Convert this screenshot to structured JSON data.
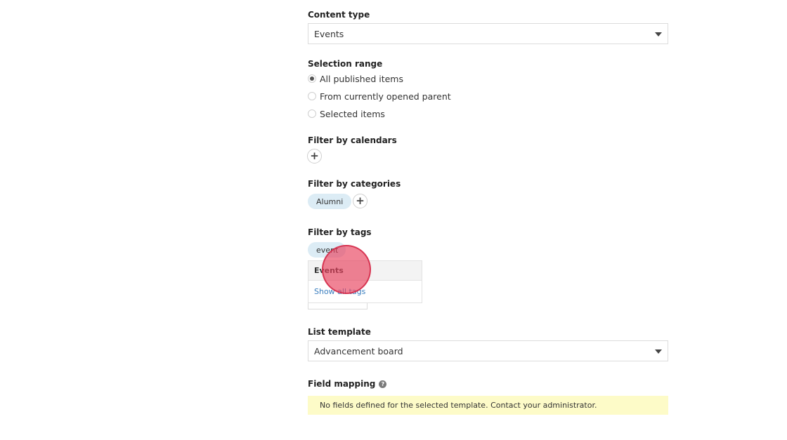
{
  "content_type": {
    "label": "Content type",
    "value": "Events"
  },
  "selection_range": {
    "label": "Selection range",
    "options": [
      {
        "label": "All published items",
        "checked": true
      },
      {
        "label": "From currently opened parent",
        "checked": false
      },
      {
        "label": "Selected items",
        "checked": false
      }
    ]
  },
  "filter_calendars": {
    "label": "Filter by calendars",
    "add_symbol": "+"
  },
  "filter_categories": {
    "label": "Filter by categories",
    "chips": [
      "Alumni"
    ],
    "add_symbol": "+"
  },
  "filter_tags": {
    "label": "Filter by tags",
    "chips": [
      "event"
    ],
    "dropdown": {
      "item": "Events",
      "link": "Show all tags"
    }
  },
  "list_template": {
    "label": "List template",
    "value": "Advancement board"
  },
  "field_mapping": {
    "label": "Field mapping",
    "help_symbol": "?",
    "notice": "No fields defined for the selected template. Contact your administrator."
  },
  "colors": {
    "chip_bg": "#dcecf5",
    "link": "#3a7ebf",
    "notice_bg": "#fdfbc8",
    "click_marker": "#e8405c"
  }
}
